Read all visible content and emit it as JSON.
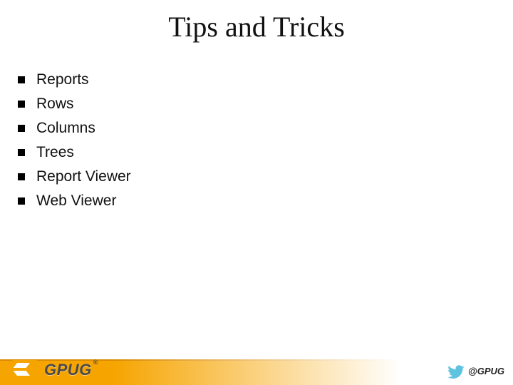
{
  "title": "Tips and Tricks",
  "bullets": [
    "Reports",
    "Rows",
    "Columns",
    "Trees",
    "Report Viewer",
    "Web Viewer"
  ],
  "footer": {
    "logo_text": "GPUG",
    "registered": "®",
    "twitter_handle": "@GPUG"
  }
}
